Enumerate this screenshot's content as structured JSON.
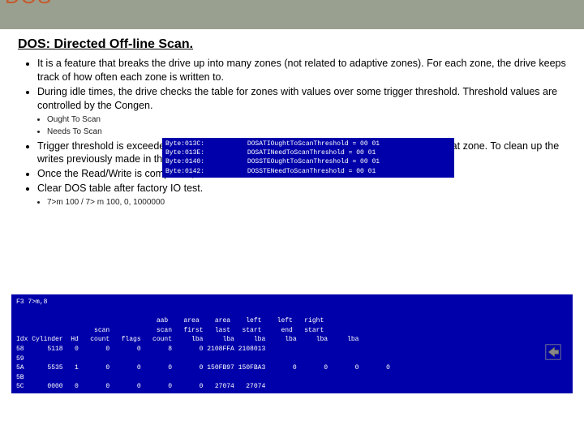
{
  "header": {
    "big_title": "DOS"
  },
  "subtitle": "DOS: Directed Off-line Scan.",
  "bullets1": {
    "a": "It is a feature that breaks the drive up into many zones (not related to adaptive zones). For each zone, the drive keeps track of how often each zone is written to.",
    "b": "During idle times, the drive checks the table for zones with values over some trigger threshold. Threshold values are controlled by the Congen."
  },
  "sub1": {
    "a": "Ought To Scan",
    "b": "Needs To Scan"
  },
  "bullets2": {
    "a": "Trigger threshold is exceeded, a Read/Verify of that zone occurs, followed by a re-Write of that zone. To clean up the writes previously made in that zone.",
    "b": "Once the Read/Write is completed, will reset DOS table.",
    "c": "Clear DOS table after factory IO test."
  },
  "sub2": {
    "a": "7>m 100 / 7> m 100, 0, 1000000"
  },
  "term_small": {
    "l1": "Byte:013C:           DOSATIOughtToScanThreshold = 00 01",
    "l2": "Byte:013E:           DOSATINeedToScanThreshold = 00 01",
    "l3": "Byte:0140:           DOSSTEOughtToScanThreshold = 00 01",
    "l4": "Byte:0142:           DOSSTENeedToScanThreshold = 00 01"
  },
  "term_large": {
    "cmd": "F3 7>m,8",
    "hdr1": "                                    aab    area    area    left    left   right",
    "hdr2": "                    scan            scan   first   last   start     end   start",
    "hdr3": "Idx Cylinder  Hd   count   flags   count     lba     lba     lba     lba     lba     lba",
    "r1": "58      5118   0       0       0       8       0 2108FFA 2108013",
    "r2": "59",
    "r3": "5A      5535   1       0       0       0       0 150FB97 150FBA3       0       0       0       0",
    "r4": "5B",
    "r5": "5C      0000   0       0       0       0       0   27074   27074"
  }
}
